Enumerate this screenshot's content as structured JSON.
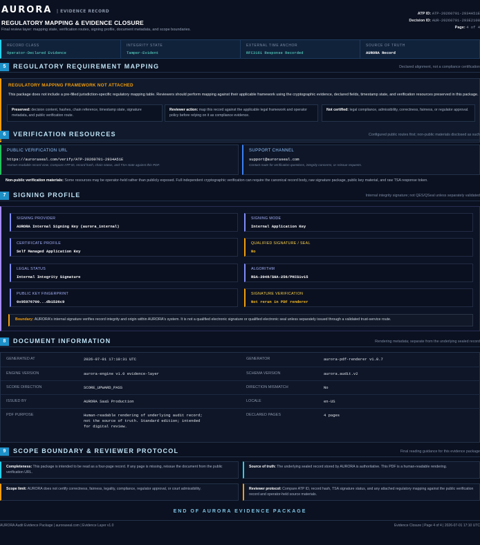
{
  "header": {
    "brand": "AURORA",
    "brand_sub": "| EVIDENCE RECORD",
    "title": "REGULATORY MAPPING & EVIDENCE CLOSURE",
    "subtitle": "Final review layer: mapping state, verification routes, signing profile, document metadata, and scope boundaries.",
    "atp_label": "ATP ID:",
    "atp_value": "ATP-20260701-2934A51E",
    "decision_label": "Decision ID:",
    "decision_value": "AUR-20260701-293E2108",
    "page_label": "Page:",
    "page_value": "4 of 4"
  },
  "record_band": [
    {
      "label": "RECORD CLASS",
      "value": "Operator-Declared Evidence"
    },
    {
      "label": "INTEGRITY STATE",
      "value": "Tamper-Evident"
    },
    {
      "label": "EXTERNAL TIME ANCHOR",
      "value": "RFC3161 Response Recorded"
    },
    {
      "label": "SOURCE OF TRUTH",
      "value": "AURORA Record"
    }
  ],
  "sections": {
    "s5": {
      "num": "5",
      "title": "REGULATORY REQUIREMENT MAPPING",
      "note": "Declared alignment, not a compliance certification"
    },
    "s6": {
      "num": "6",
      "title": "VERIFICATION RESOURCES",
      "note": "Configured public routes first; non-public materials disclosed as such"
    },
    "s7": {
      "num": "7",
      "title": "SIGNING PROFILE",
      "note": "Internal integrity signature; not QES/QSeal unless separately validated"
    },
    "s8": {
      "num": "8",
      "title": "DOCUMENT INFORMATION",
      "note": "Rendering metadata; separate from the underlying sealed record"
    },
    "s9": {
      "num": "9",
      "title": "SCOPE BOUNDARY & REVIEWER PROTOCOL",
      "note": "Final reading guidance for this evidence package"
    }
  },
  "mapping": {
    "warning_title": "REGULATORY MAPPING FRAMEWORK NOT ATTACHED",
    "warning_body": "This package does not include a pre-filled jurisdiction-specific regulatory mapping table. Reviewers should perform mapping against their applicable framework using the cryptographic evidence, declared fields, timestamp state, and verification resources preserved in this package.",
    "boxes": [
      {
        "label": "Preserved:",
        "text": "decision content, hashes, chain reference, timestamp state, signature metadata, and public verification route."
      },
      {
        "label": "Reviewer action:",
        "text": "map this record against the applicable legal framework and operator policy before relying on it as compliance evidence."
      },
      {
        "label": "Not certified:",
        "text": "legal compliance, admissibility, correctness, fairness, or regulator approval."
      }
    ]
  },
  "resources": {
    "public_label": "PUBLIC VERIFICATION URL",
    "public_value": "https://auroraseal.com/verify/ATP-20260701-2934A51E",
    "public_note": "Human-readable record view. Compare ATP ID, record hash, chain status, and TSA state against this PDF.",
    "support_label": "SUPPORT CHANNEL",
    "support_value": "support@auroraseal.com",
    "support_note": "Contact route for verification questions, integrity concerns, or reissue requests.",
    "nonpublic_label": "Non-public verification materials:",
    "nonpublic_text": "Some resources may be operator-held rather than publicly exposed. Full independent cryptographic verification can require the canonical record body, raw signature package, public key material, and raw TSA response token."
  },
  "signing": {
    "fields": [
      {
        "label": "SIGNING PROVIDER",
        "value": "AURORA Internal Signing Key (aurora_internal)"
      },
      {
        "label": "SIGNING MODE",
        "value": "Internal Application Key"
      },
      {
        "label": "CERTIFICATE PROFILE",
        "value": "Self Managed Application Key"
      },
      {
        "label": "QUALIFIED SIGNATURE / SEAL",
        "value": "No"
      },
      {
        "label": "LEGAL STATUS",
        "value": "Internal Integrity Signature"
      },
      {
        "label": "ALGORITHM",
        "value": "RSA-2048/SHA-256/PKCS1v15"
      },
      {
        "label": "PUBLIC KEY FINGERPRINT",
        "value": "0x95976700...db1526c9"
      },
      {
        "label": "SIGNATURE VERIFICATION",
        "value": "Not rerun in PDF renderer"
      }
    ],
    "boundary_label": "Boundary:",
    "boundary_text": "AURORA's internal signature verifies record integrity and origin within AURORA's system. It is not a qualified electronic signature or qualified electronic seal unless separately issued through a validated trust-service route."
  },
  "docinfo": {
    "rows": [
      {
        "k1": "GENERATED AT",
        "v1": "2026-07-01 17:10:31 UTC",
        "k2": "GENERATOR",
        "v2": "aurora-pdf-renderer v1.0.7"
      },
      {
        "k1": "ENGINE VERSION",
        "v1": "aurora-engine v1.0 evidence-layer",
        "k2": "SCHEMA VERSION",
        "v2": "aurora.audit.v2"
      },
      {
        "k1": "SCORE DIRECTION",
        "v1": "SCORE_UPWARD_PASS",
        "k2": "DIRECTION MISMATCH",
        "v2": "No"
      },
      {
        "k1": "ISSUED BY",
        "v1": "AURORA SaaS Production",
        "k2": "LOCALE",
        "v2": "en-US"
      },
      {
        "k1": "PDF PURPOSE",
        "v1": "Human-readable rendering of underlying audit record; not the source of truth. Standard edition; intended for digital review.",
        "k2": "DECLARED PAGES",
        "v2": "4 pages"
      }
    ]
  },
  "scope": [
    {
      "label": "Completeness:",
      "text": "This package is intended to be read as a four-page record. If any page is missing, reissue the document from the public verification URL."
    },
    {
      "label": "Source of truth:",
      "text": "The underlying sealed record stored by AURORA is authoritative. This PDF is a human-readable rendering."
    },
    {
      "label": "Scope limit:",
      "text": "AURORA does not certify correctness, fairness, legality, compliance, regulator approval, or court admissibility."
    },
    {
      "label": "Reviewer protocol:",
      "text": "Compare ATP ID, record hash, TSA signature status, and any attached regulatory mapping against the public verification record and operator-held source materials."
    }
  ],
  "end_text": "END OF AURORA EVIDENCE PACKAGE",
  "footer": {
    "left": "AURORA Audit Evidence Package  |  auroraseal.com  |  Evidence Layer v1.0",
    "right": "Evidence Closure  |  Page 4 of 4  |  2026-07-01 17:10 UTC"
  }
}
